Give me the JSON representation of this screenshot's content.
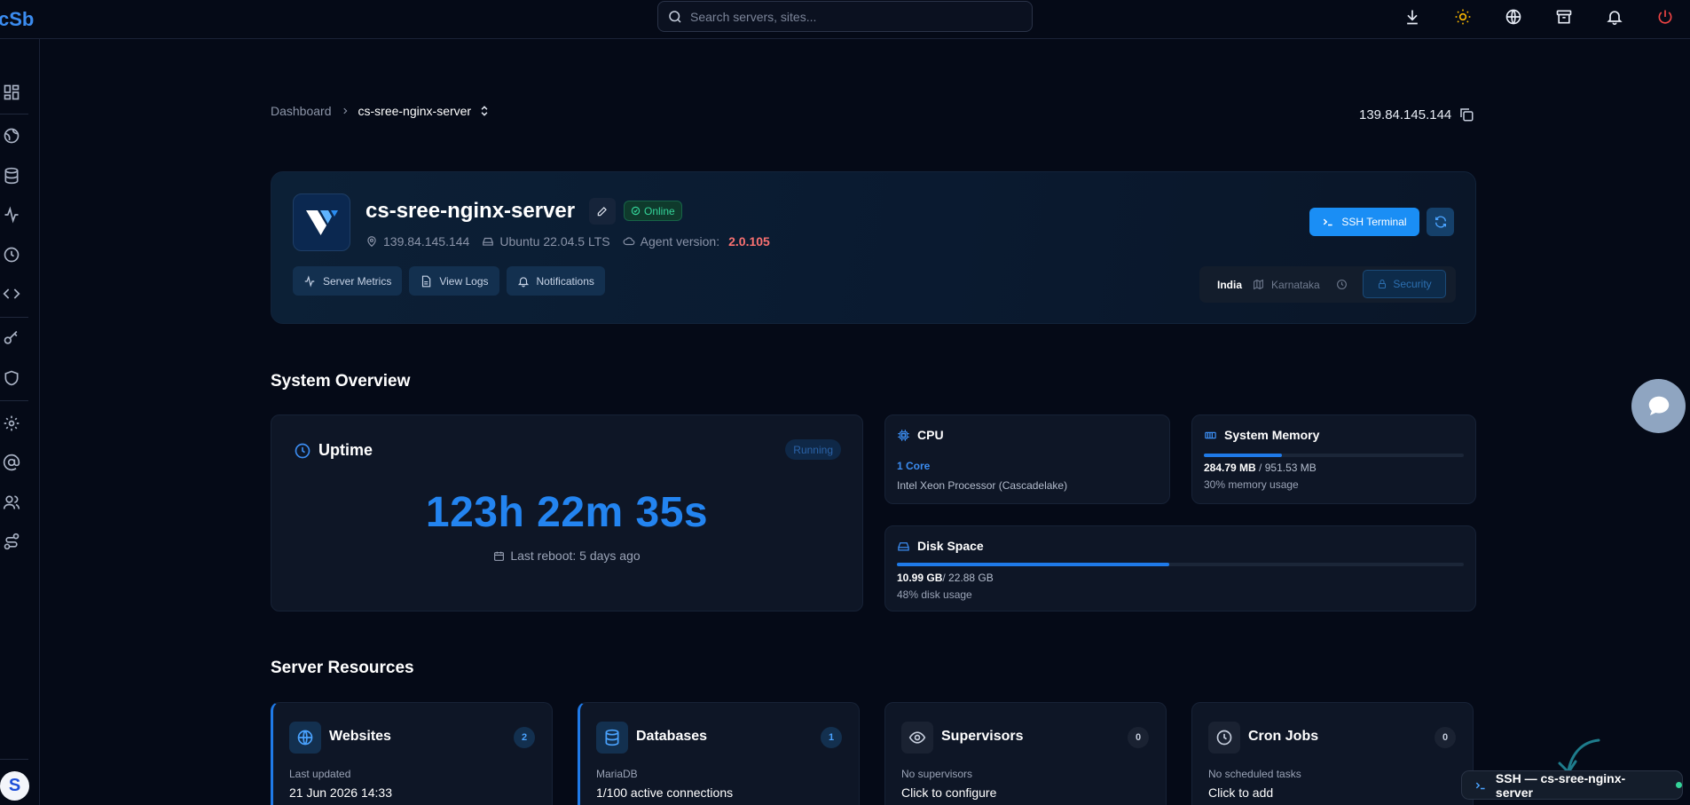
{
  "header": {
    "logo_text": "cSb",
    "search_placeholder": "Search servers, sites...",
    "icons": [
      "download-icon",
      "sun-icon",
      "globe-icon",
      "archive-icon",
      "bell-icon",
      "power-icon"
    ]
  },
  "sidebar": {
    "icons": [
      "dashboard-icon",
      "globe-icon",
      "database-icon",
      "activity-icon",
      "clock-icon",
      "code-icon",
      "key-icon",
      "shield-icon",
      "settings-icon",
      "at-sign-icon",
      "users-icon",
      "route-icon"
    ],
    "avatar_initial": "S"
  },
  "breadcrumb": {
    "root": "Dashboard",
    "current": "cs-sree-nginx-server"
  },
  "ip_address": "139.84.145.144",
  "server": {
    "name": "cs-sree-nginx-server",
    "status": "Online",
    "ip": "139.84.145.144",
    "os": "Ubuntu 22.04.5 LTS",
    "agent_label": "Agent version:",
    "agent_version": "2.0.105",
    "actions": {
      "metrics": "Server Metrics",
      "logs": "View Logs",
      "notifications": "Notifications"
    },
    "ssh_label": "SSH Terminal",
    "location": {
      "country": "India",
      "state": "Karnataka"
    },
    "security_label": "Security"
  },
  "overview": {
    "title": "System Overview",
    "uptime": {
      "title": "Uptime",
      "status": "Running",
      "value": "123h 22m 35s",
      "reboot": "Last reboot: 5 days ago"
    },
    "cpu": {
      "title": "CPU",
      "cores": "1 Core",
      "model": "Intel Xeon Processor (Cascadelake)"
    },
    "memory": {
      "title": "System Memory",
      "used": "284.79 MB",
      "total": "/ 951.53 MB",
      "usage": "30% memory usage",
      "percent": 30
    },
    "disk": {
      "title": "Disk Space",
      "used": "10.99 GB",
      "total": "/ 22.88 GB",
      "usage": "48% disk usage",
      "percent": 48
    }
  },
  "resources": {
    "title": "Server Resources",
    "items": [
      {
        "title": "Websites",
        "count": "2",
        "sub": "Last updated",
        "main": "21 Jun 2026 14:33"
      },
      {
        "title": "Databases",
        "count": "1",
        "sub": "MariaDB",
        "main": "1/100 active connections"
      },
      {
        "title": "Supervisors",
        "count": "0",
        "sub": "No supervisors",
        "main": "Click to configure"
      },
      {
        "title": "Cron Jobs",
        "count": "0",
        "sub": "No scheduled tasks",
        "main": "Click to add"
      }
    ]
  },
  "ssh_session": {
    "label": "SSH — cs-sree-nginx-server"
  },
  "colors": {
    "accent": "#1f7ae8",
    "online": "#34d399",
    "version": "#f87171",
    "power": "#ef4444",
    "sun": "#f5b400"
  }
}
